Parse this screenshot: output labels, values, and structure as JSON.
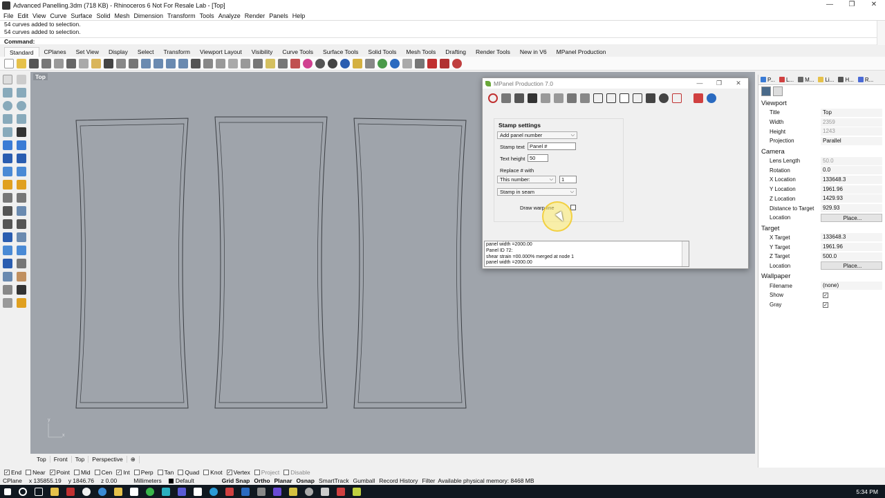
{
  "window": {
    "title": "Advanced Panelling.3dm (718 KB) - Rhinoceros 6 Not For Resale Lab - [Top]",
    "min": "—",
    "max": "❐",
    "close": "✕"
  },
  "menu": [
    "File",
    "Edit",
    "View",
    "Curve",
    "Surface",
    "Solid",
    "Mesh",
    "Dimension",
    "Transform",
    "Tools",
    "Analyze",
    "Render",
    "Panels",
    "Help"
  ],
  "command": {
    "history": [
      "54 curves added to selection.",
      "54 curves added to selection."
    ],
    "prompt": "Command:"
  },
  "toolbar_tabs": [
    "Standard",
    "CPlanes",
    "Set View",
    "Display",
    "Select",
    "Transform",
    "Viewport Layout",
    "Visibility",
    "Curve Tools",
    "Surface Tools",
    "Solid Tools",
    "Mesh Tools",
    "Drafting",
    "Render Tools",
    "New in V6",
    "MPanel Production"
  ],
  "viewport": {
    "label": "Top",
    "axis_y": "y",
    "axis_x": "x"
  },
  "viewport_tabs": [
    "Top",
    "Front",
    "Top",
    "Perspective",
    "⊕"
  ],
  "osnaps": [
    {
      "label": "End",
      "checked": true
    },
    {
      "label": "Near",
      "checked": false
    },
    {
      "label": "Point",
      "checked": true
    },
    {
      "label": "Mid",
      "checked": false
    },
    {
      "label": "Cen",
      "checked": false
    },
    {
      "label": "Int",
      "checked": true
    },
    {
      "label": "Perp",
      "checked": false
    },
    {
      "label": "Tan",
      "checked": false
    },
    {
      "label": "Quad",
      "checked": false
    },
    {
      "label": "Knot",
      "checked": false
    },
    {
      "label": "Vertex",
      "checked": true
    },
    {
      "label": "Project",
      "checked": false
    },
    {
      "label": "Disable",
      "checked": false
    }
  ],
  "status": {
    "cplane": "CPlane",
    "x": "x 135855.19",
    "y": "y 1846.76",
    "z": "z 0.00",
    "units": "Millimeters",
    "layer": "Default",
    "modes": [
      "Grid Snap",
      "Ortho",
      "Planar",
      "Osnap"
    ],
    "other": [
      "SmartTrack",
      "Gumball",
      "Record History",
      "Filter"
    ],
    "memory": "Available physical memory: 8468 MB"
  },
  "taskbar": {
    "time": "5:34 PM"
  },
  "properties": {
    "tabs": [
      "P...",
      "L...",
      "M...",
      "Li...",
      "H...",
      "R..."
    ],
    "sections": [
      {
        "title": "Viewport",
        "rows": [
          {
            "label": "Title",
            "value": "Top",
            "type": "text"
          },
          {
            "label": "Width",
            "value": "2359",
            "type": "dis"
          },
          {
            "label": "Height",
            "value": "1243",
            "type": "dis"
          },
          {
            "label": "Projection",
            "value": "Parallel",
            "type": "text"
          }
        ]
      },
      {
        "title": "Camera",
        "rows": [
          {
            "label": "Lens Length",
            "value": "50.0",
            "type": "dis"
          },
          {
            "label": "Rotation",
            "value": "0.0",
            "type": "text"
          },
          {
            "label": "X Location",
            "value": "133648.3",
            "type": "text"
          },
          {
            "label": "Y Location",
            "value": "1961.96",
            "type": "text"
          },
          {
            "label": "Z Location",
            "value": "1429.93",
            "type": "text"
          },
          {
            "label": "Distance to Target",
            "value": "929.93",
            "type": "text"
          },
          {
            "label": "Location",
            "value": "Place...",
            "type": "btn"
          }
        ]
      },
      {
        "title": "Target",
        "rows": [
          {
            "label": "X Target",
            "value": "133648.3",
            "type": "text"
          },
          {
            "label": "Y Target",
            "value": "1961.96",
            "type": "text"
          },
          {
            "label": "Z Target",
            "value": "500.0",
            "type": "text"
          },
          {
            "label": "Location",
            "value": "Place...",
            "type": "btn"
          }
        ]
      },
      {
        "title": "Wallpaper",
        "rows": [
          {
            "label": "Filename",
            "value": "(none)",
            "type": "text"
          },
          {
            "label": "Show",
            "value": "✓",
            "type": "cb"
          },
          {
            "label": "Gray",
            "value": "✓",
            "type": "cb"
          }
        ]
      }
    ]
  },
  "mpanel": {
    "title": "MPanel Production 7.0",
    "stamp": {
      "heading": "Stamp settings",
      "mode": "Add panel number",
      "stamp_text_label": "Stamp text",
      "stamp_text_value": "Panel #",
      "text_height_label": "Text height",
      "text_height_value": "50",
      "replace_label": "Replace # with",
      "replace_mode": "This number:",
      "replace_value": "1",
      "placement": "Stamp in seam",
      "warp_label": "Draw warp line"
    },
    "log": [
      "panel width =2000.00",
      "Panel ID 72:",
      "shear strain =00.000% merged at node 1",
      "panel width =2000.00"
    ]
  },
  "colors": {
    "viewport_bg": "#9fa4ab",
    "panel_outline": "#3a3d42",
    "taskbar": "#101820"
  }
}
